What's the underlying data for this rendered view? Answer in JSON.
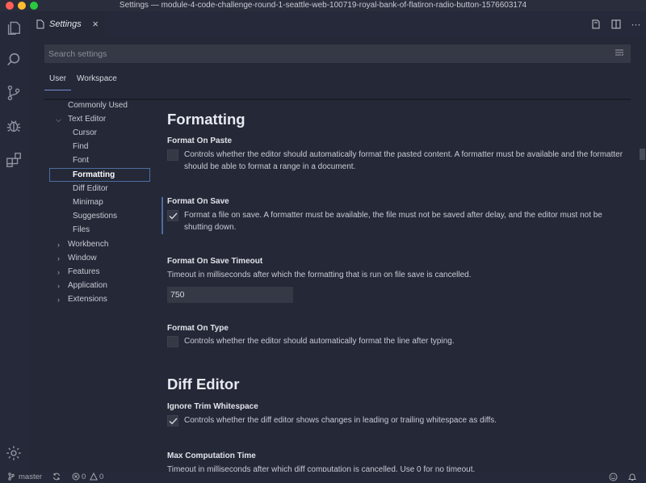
{
  "window": {
    "title": "Settings — module-4-code-challenge-round-1-seattle-web-100719-royal-bank-of-flatiron-radio-button-1576603174"
  },
  "activity_bar": {
    "icons": [
      "files-icon",
      "search-icon",
      "source-control-icon",
      "debug-icon",
      "extensions-icon",
      "settings-gear-icon"
    ]
  },
  "tab": {
    "title": "Settings",
    "close": "×"
  },
  "editor_actions": {
    "more": "···"
  },
  "search": {
    "placeholder": "Search settings",
    "value": ""
  },
  "scopes": {
    "user": "User",
    "workspace": "Workspace"
  },
  "toc": {
    "commonly_used": "Commonly Used",
    "text_editor": "Text Editor",
    "cursor": "Cursor",
    "find": "Find",
    "font": "Font",
    "formatting": "Formatting",
    "diff_editor": "Diff Editor",
    "minimap": "Minimap",
    "suggestions": "Suggestions",
    "files": "Files",
    "workbench": "Workbench",
    "window": "Window",
    "features": "Features",
    "application": "Application",
    "extensions": "Extensions"
  },
  "sections": {
    "formatting": {
      "title": "Formatting",
      "format_on_paste": {
        "title": "Format On Paste",
        "desc": "Controls whether the editor should automatically format the pasted content. A formatter must be available and the formatter should be able to format a range in a document.",
        "checked": false
      },
      "format_on_save": {
        "title": "Format On Save",
        "desc": "Format a file on save. A formatter must be available, the file must not be saved after delay, and the editor must not be shutting down.",
        "checked": true
      },
      "format_on_save_timeout": {
        "title": "Format On Save Timeout",
        "desc": "Timeout in milliseconds after which the formatting that is run on file save is cancelled.",
        "value": "750"
      },
      "format_on_type": {
        "title": "Format On Type",
        "desc": "Controls whether the editor should automatically format the line after typing.",
        "checked": false
      }
    },
    "diff_editor": {
      "title": "Diff Editor",
      "ignore_trim_whitespace": {
        "title": "Ignore Trim Whitespace",
        "desc": "Controls whether the diff editor shows changes in leading or trailing whitespace as diffs.",
        "checked": true
      },
      "max_computation_time": {
        "title": "Max Computation Time",
        "desc": "Timeout in milliseconds after which diff computation is cancelled. Use 0 for no timeout."
      }
    }
  },
  "status_bar": {
    "branch": "master",
    "errors": "0",
    "warnings": "0"
  }
}
